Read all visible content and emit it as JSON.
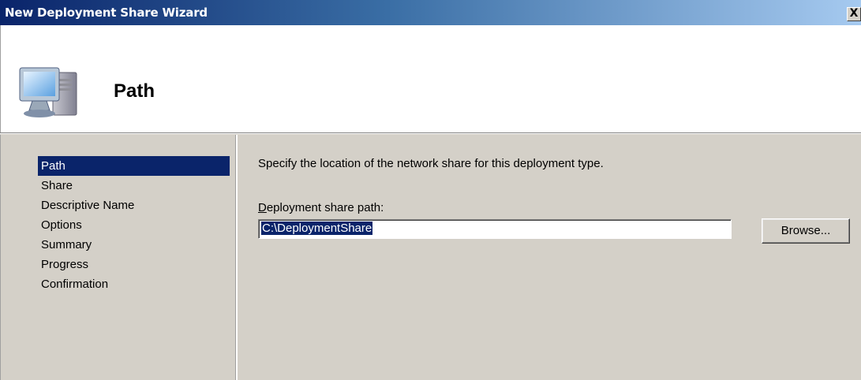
{
  "window": {
    "title": "New Deployment Share Wizard",
    "close_label": "X"
  },
  "header": {
    "title": "Path",
    "icon": "computer-icon"
  },
  "nav": {
    "items": [
      {
        "label": "Path",
        "selected": true
      },
      {
        "label": "Share",
        "selected": false
      },
      {
        "label": "Descriptive Name",
        "selected": false
      },
      {
        "label": "Options",
        "selected": false
      },
      {
        "label": "Summary",
        "selected": false
      },
      {
        "label": "Progress",
        "selected": false
      },
      {
        "label": "Confirmation",
        "selected": false
      }
    ]
  },
  "content": {
    "instruction": "Specify the location of the network share for this deployment type.",
    "path_label_access_key": "D",
    "path_label_rest": "eployment share path:",
    "path_value": "C:\\DeploymentShare",
    "browse_label": "Browse..."
  },
  "colors": {
    "selection": "#0a246a",
    "dialog_bg": "#d4d0c8",
    "title_gradient_start": "#0a246a",
    "title_gradient_end": "#a6caf0"
  }
}
